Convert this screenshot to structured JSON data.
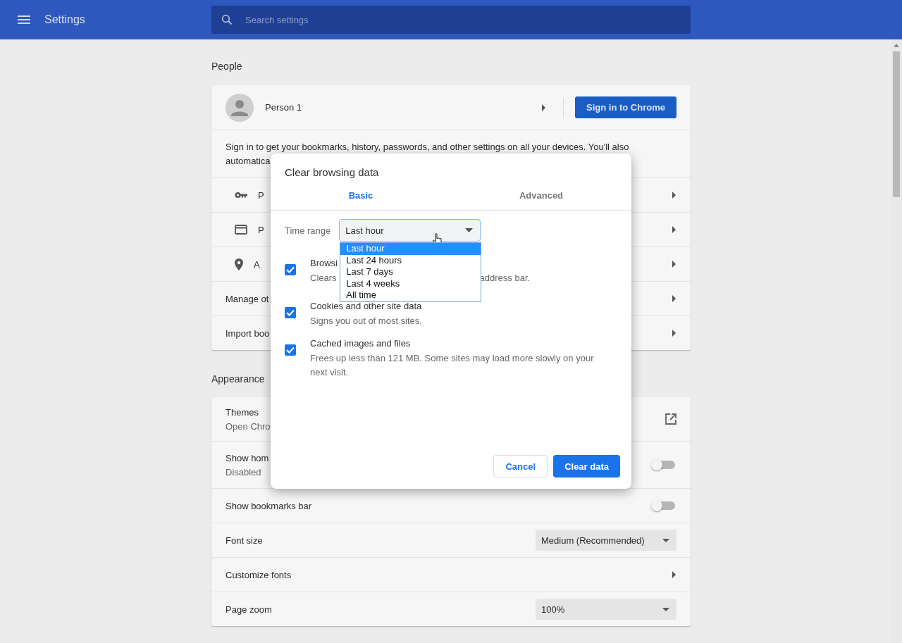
{
  "header": {
    "title": "Settings",
    "search": {
      "placeholder": "Search settings"
    }
  },
  "people": {
    "heading": "People",
    "profile": {
      "name": "Person 1",
      "button": "Sign in to Chrome"
    },
    "sign_in_lines": [
      "Sign in to get your bookmarks, history, passwords, and other settings on all your devices. You'll also",
      "automatica"
    ],
    "rows": [
      {
        "kind": "key",
        "label": "P"
      },
      {
        "kind": "card",
        "label": "P"
      },
      {
        "kind": "pin",
        "label": "A"
      },
      {
        "kind": "plain",
        "label": "Manage ot"
      },
      {
        "kind": "plain",
        "label": "Import boo"
      }
    ]
  },
  "appearance": {
    "heading": "Appearance",
    "rows": [
      {
        "kind": "link",
        "label": "Themes",
        "sublabel": "Open Chro"
      },
      {
        "kind": "toggle",
        "label": "Show hom",
        "sublabel": "Disabled",
        "on": false
      },
      {
        "kind": "toggle",
        "label": "Show bookmarks bar",
        "on": false
      },
      {
        "kind": "select",
        "label": "Font size",
        "value": "Medium (Recommended)"
      },
      {
        "kind": "arrow",
        "label": "Customize fonts"
      },
      {
        "kind": "select",
        "label": "Page zoom",
        "value": "100%"
      }
    ]
  },
  "dialog": {
    "title": "Clear browsing data",
    "tabs": [
      {
        "label": "Basic",
        "selected": true
      },
      {
        "label": "Advanced",
        "selected": false
      }
    ],
    "time_range": {
      "label": "Time range",
      "value": "Last hour",
      "expanded": true,
      "options": [
        {
          "label": "Last hour",
          "selected": true
        },
        {
          "label": "Last 24 hours",
          "selected": false
        },
        {
          "label": "Last 7 days",
          "selected": false
        },
        {
          "label": "Last 4 weeks",
          "selected": false
        },
        {
          "label": "All time",
          "selected": false
        }
      ]
    },
    "items": [
      {
        "title": "Browsi",
        "description": "Clears",
        "description_end": "address bar.",
        "checked": true
      },
      {
        "title": "Cookies and other site data",
        "description": "Signs you out of most sites.",
        "checked": true
      },
      {
        "title": "Cached images and files",
        "description": "Frees up less than 121 MB. Some sites may load more slowly on your next visit.",
        "checked": true
      }
    ],
    "buttons": {
      "cancel": "Cancel",
      "confirm": "Clear data"
    }
  }
}
